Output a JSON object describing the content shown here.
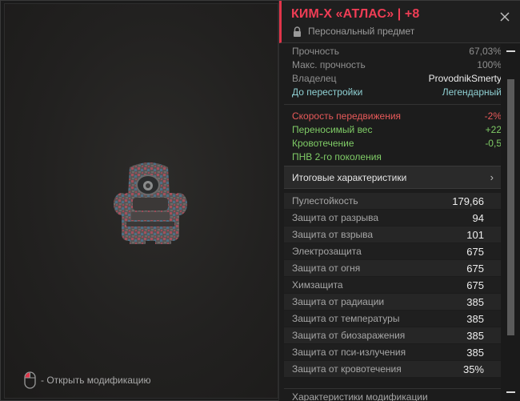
{
  "item": {
    "title": "КИМ-Х «АТЛАС» | +8",
    "subtitle": "Персональный предмет"
  },
  "info_rows": [
    {
      "label": "Прочность",
      "value": "67,03%"
    },
    {
      "label": "Макс. прочность",
      "value": "100%"
    },
    {
      "label": "Владелец",
      "value": "ProvodnikSmerty"
    },
    {
      "label": "До перестройки",
      "value": "Легендарный"
    }
  ],
  "effects": [
    {
      "label": "Скорость передвижения",
      "value": "-2%"
    },
    {
      "label": "Переносимый вес",
      "value": "+22"
    },
    {
      "label": "Кровотечение",
      "value": "-0,5"
    },
    {
      "label": "ПНВ 2-го поколения",
      "value": ""
    }
  ],
  "summary_button": {
    "label": "Итоговые характеристики",
    "chevron": "›"
  },
  "stats": [
    {
      "label": "Пулестойкость",
      "value": "179,66"
    },
    {
      "label": "Защита от разрыва",
      "value": "94"
    },
    {
      "label": "Защита от взрыва",
      "value": "101"
    },
    {
      "label": "Электрозащита",
      "value": "675"
    },
    {
      "label": "Защита от огня",
      "value": "675"
    },
    {
      "label": "Химзащита",
      "value": "675"
    },
    {
      "label": "Защита от радиации",
      "value": "385"
    },
    {
      "label": "Защита от температуры",
      "value": "385"
    },
    {
      "label": "Защита от биозаражения",
      "value": "385"
    },
    {
      "label": "Защита от пси-излучения",
      "value": "385"
    },
    {
      "label": "Защита от кровотечения",
      "value": "35%"
    }
  ],
  "footer_section": "Характеристики модификации",
  "hint": {
    "text": "- Открыть модификацию",
    "icon": "mouse-left-click-icon"
  },
  "colors": {
    "accent_red": "#ef3d55",
    "negative": "#e85a5a",
    "positive": "#7fcc66",
    "rarity_legendary": "#8fd0d3"
  }
}
